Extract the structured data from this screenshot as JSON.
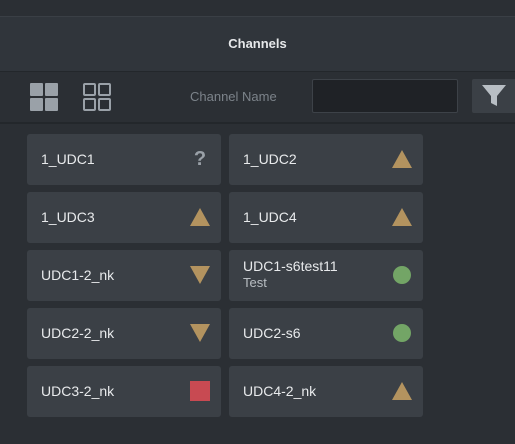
{
  "panel": {
    "title": "Channels"
  },
  "toolbar": {
    "view_modes": [
      {
        "name": "filled-grid-icon",
        "selected": true
      },
      {
        "name": "outline-grid-icon",
        "selected": false
      }
    ],
    "filter_label": "Channel Name",
    "filter_value": "",
    "filter_button_icon": "filter-funnel-icon"
  },
  "colors": {
    "background": "#2b2f34",
    "tile": "#3b4046",
    "warning_triangle": "#b3935f",
    "ok_circle": "#73a566",
    "error_square": "#c84a52",
    "unknown": "#9aa1a8"
  },
  "channels": [
    {
      "name": "1_UDC1",
      "status": "unknown"
    },
    {
      "name": "1_UDC2",
      "status": "triangle-up"
    },
    {
      "name": "1_UDC3",
      "status": "triangle-up"
    },
    {
      "name": "1_UDC4",
      "status": "triangle-up"
    },
    {
      "name": "UDC1-2_nk",
      "status": "triangle-down"
    },
    {
      "name": "UDC1-s6test11",
      "sub": "Test",
      "status": "circle"
    },
    {
      "name": "UDC2-2_nk",
      "status": "triangle-down"
    },
    {
      "name": "UDC2-s6",
      "status": "circle"
    },
    {
      "name": "UDC3-2_nk",
      "status": "square"
    },
    {
      "name": "UDC4-2_nk",
      "status": "triangle-up"
    }
  ]
}
